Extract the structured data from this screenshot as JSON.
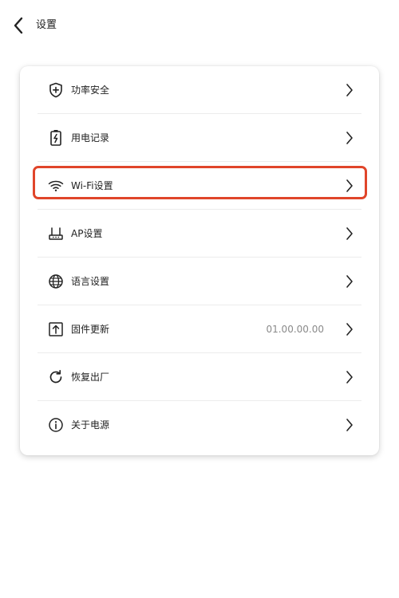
{
  "header": {
    "title": "设置",
    "back_icon": "chevron-left-icon"
  },
  "menu": {
    "items": [
      {
        "id": "power-security",
        "label": "功率安全",
        "icon": "shield-plus-icon",
        "value": ""
      },
      {
        "id": "power-records",
        "label": "用电记录",
        "icon": "battery-bolt-icon",
        "value": ""
      },
      {
        "id": "wifi-settings",
        "label": "Wi-Fi设置",
        "icon": "wifi-icon",
        "value": "",
        "highlighted": true
      },
      {
        "id": "ap-settings",
        "label": "AP设置",
        "icon": "router-icon",
        "value": ""
      },
      {
        "id": "language-settings",
        "label": "语言设置",
        "icon": "globe-icon",
        "value": ""
      },
      {
        "id": "firmware-update",
        "label": "固件更新",
        "icon": "upload-box-icon",
        "value": "01.00.00.00"
      },
      {
        "id": "factory-reset",
        "label": "恢复出厂",
        "icon": "refresh-icon",
        "value": ""
      },
      {
        "id": "about-power",
        "label": "关于电源",
        "icon": "info-icon",
        "value": ""
      }
    ]
  },
  "colors": {
    "highlight": "#e0452a",
    "text": "#222222",
    "secondary_text": "#8a8a8a",
    "divider": "#ececec"
  }
}
